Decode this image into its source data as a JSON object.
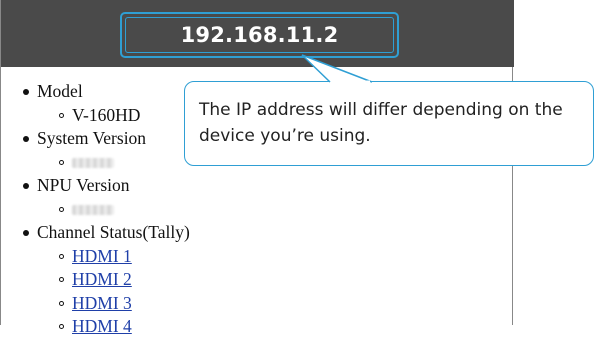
{
  "header": {
    "ip_address": "192.168.11.2"
  },
  "callout": {
    "line1": "The IP address will differ depending on the",
    "line2": "device you’re using."
  },
  "status_list": {
    "model": {
      "label": "Model",
      "value": "V-160HD"
    },
    "system_version": {
      "label": "System Version"
    },
    "npu_version": {
      "label": "NPU Version"
    },
    "channel_status": {
      "label": "Channel Status(Tally)",
      "links": [
        "HDMI 1",
        "HDMI 2",
        "HDMI 3",
        "HDMI 4"
      ]
    }
  },
  "colors": {
    "accent": "#2f9fd4",
    "header_bg": "#4a4a4a",
    "link": "#1f3fa8"
  }
}
